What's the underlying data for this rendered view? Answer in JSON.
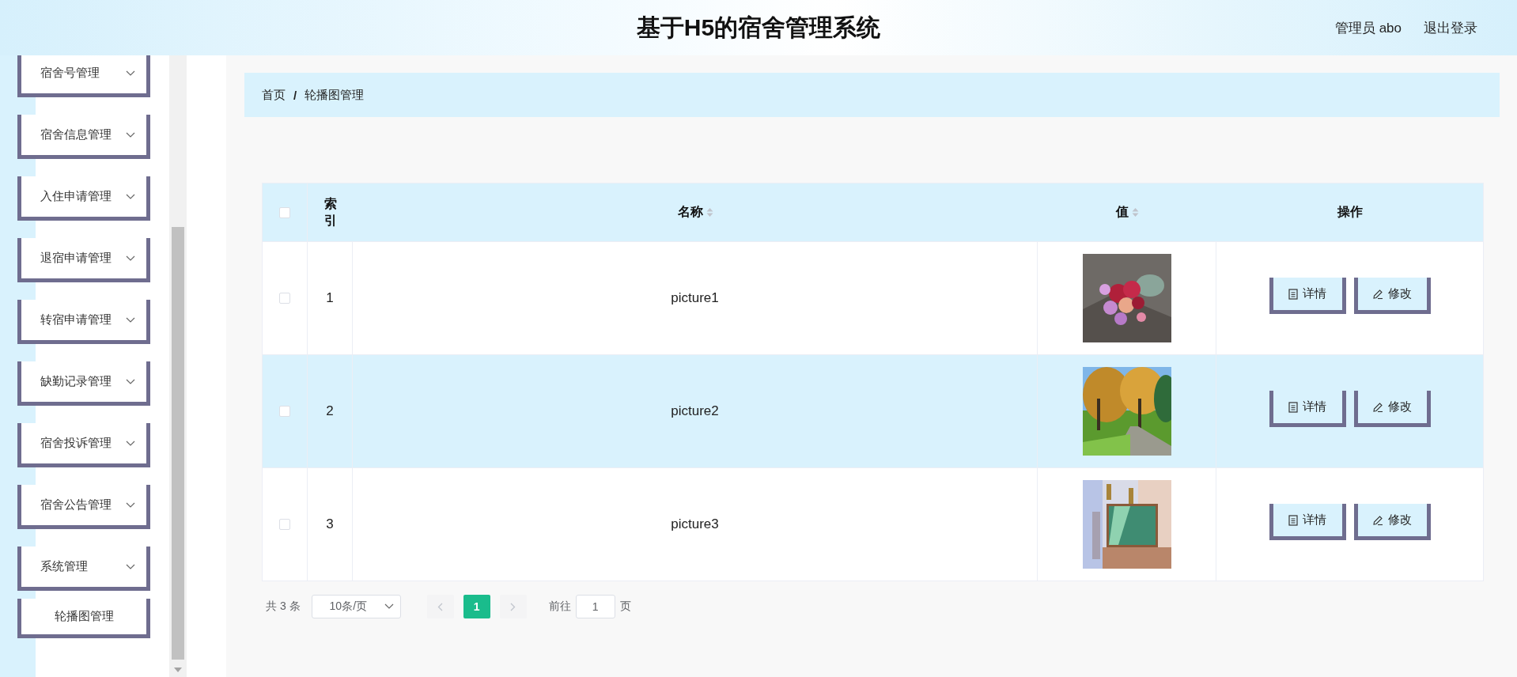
{
  "header": {
    "title": "基于H5的宿舍管理系统",
    "user": "管理员 abo",
    "logout": "退出登录"
  },
  "sidebar": {
    "items": [
      {
        "label": "宿舍号管理",
        "kind": "menu"
      },
      {
        "label": "宿舍信息管理",
        "kind": "menu"
      },
      {
        "label": "入住申请管理",
        "kind": "menu"
      },
      {
        "label": "退宿申请管理",
        "kind": "menu"
      },
      {
        "label": "转宿申请管理",
        "kind": "menu"
      },
      {
        "label": "缺勤记录管理",
        "kind": "menu"
      },
      {
        "label": "宿舍投诉管理",
        "kind": "menu"
      },
      {
        "label": "宿舍公告管理",
        "kind": "menu"
      },
      {
        "label": "系统管理",
        "kind": "menu"
      },
      {
        "label": "轮播图管理",
        "kind": "sub"
      }
    ]
  },
  "breadcrumb": {
    "items": [
      "首页",
      "轮播图管理"
    ],
    "separator": "/"
  },
  "table": {
    "columns": [
      {
        "kind": "checkbox",
        "checked": false
      },
      {
        "kind": "text",
        "label": "索引"
      },
      {
        "kind": "sortable",
        "label": "名称"
      },
      {
        "kind": "sortable",
        "label": "值"
      },
      {
        "kind": "text",
        "label": "操作"
      }
    ],
    "rows": [
      {
        "checked": false,
        "index": "1",
        "name": "picture1",
        "value": {
          "kind": "picture"
        },
        "highlighted": false,
        "actions": [
          {
            "kind": "detail",
            "label": "详情"
          },
          {
            "kind": "edit",
            "label": "修改"
          }
        ]
      },
      {
        "checked": false,
        "index": "2",
        "name": "picture2",
        "value": {
          "kind": "picture"
        },
        "highlighted": true,
        "actions": [
          {
            "kind": "detail",
            "label": "详情"
          },
          {
            "kind": "edit",
            "label": "修改"
          }
        ]
      },
      {
        "checked": false,
        "index": "3",
        "name": "picture3",
        "value": {
          "kind": "picture"
        },
        "highlighted": false,
        "actions": [
          {
            "kind": "detail",
            "label": "详情"
          },
          {
            "kind": "edit",
            "label": "修改"
          }
        ]
      }
    ]
  },
  "pagination": {
    "total": "共 3 条",
    "page_size": "10条/页",
    "pages": [
      {
        "label": "1",
        "selected": true
      }
    ],
    "goto_label": "前往",
    "goto_value": "1",
    "page_suffix": "页"
  }
}
